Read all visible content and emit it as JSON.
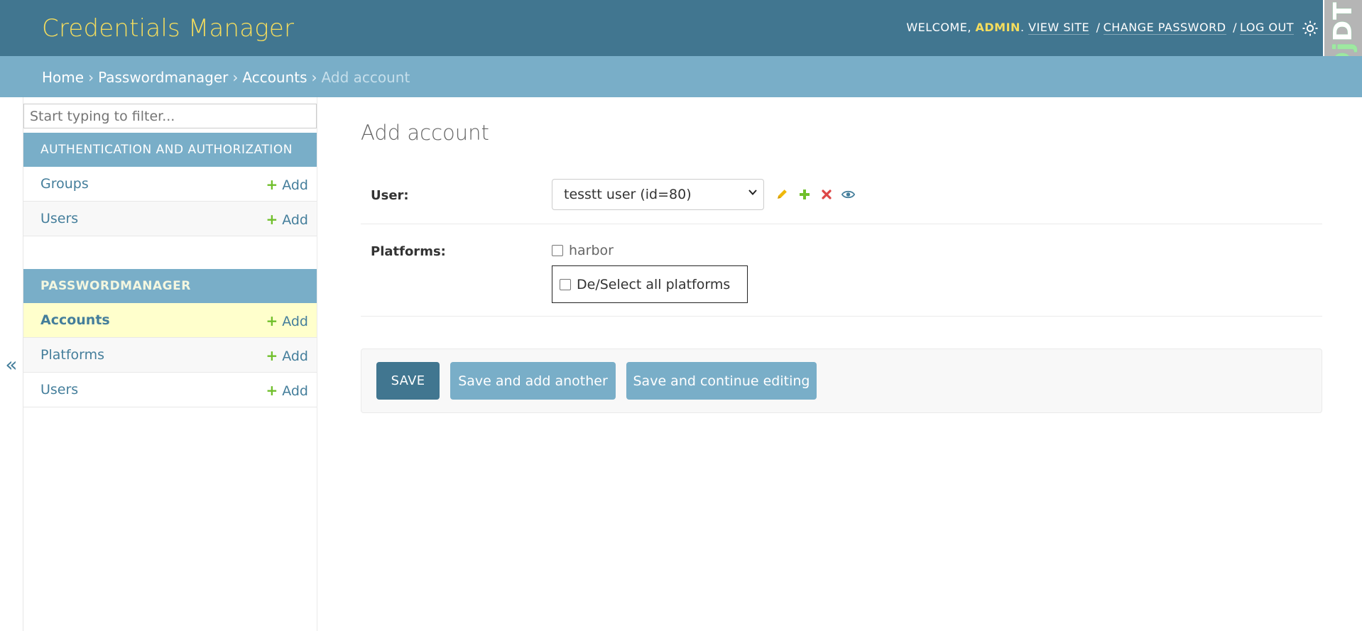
{
  "header": {
    "title": "Credentials Manager",
    "welcome": "WELCOME,",
    "user": "ADMIN",
    "view_site": "VIEW SITE",
    "change_password": "CHANGE PASSWORD",
    "log_out": "LOG OUT",
    "sep": "/"
  },
  "debug_toolbar": {
    "label_dj": "Dj",
    "label_dt": "DT"
  },
  "breadcrumbs": {
    "home": "Home",
    "app": "Passwordmanager",
    "model": "Accounts",
    "current": "Add account",
    "sep": "›"
  },
  "sidebar": {
    "toggle": "«",
    "filter_placeholder": "Start typing to filter...",
    "modules": [
      {
        "caption": "Authentication and Authorization",
        "rows": [
          {
            "label": "Groups",
            "add": "Add"
          },
          {
            "label": "Users",
            "add": "Add"
          }
        ]
      },
      {
        "caption": "PASSWORDMANAGER",
        "rows": [
          {
            "label": "Accounts",
            "add": "Add"
          },
          {
            "label": "Platforms",
            "add": "Add"
          },
          {
            "label": "Users",
            "add": "Add"
          }
        ]
      }
    ],
    "add_icon": "+"
  },
  "content": {
    "title": "Add account",
    "user_label": "User:",
    "user_value": "tesstt user (id=80)",
    "platforms_label": "Platforms:",
    "platform_options": [
      "harbor"
    ],
    "select_all": "De/Select all platforms"
  },
  "actions": {
    "save": "Save",
    "save_add_another": "Save and add another",
    "save_continue": "Save and continue editing"
  },
  "colors": {
    "header_bg": "#417690",
    "breadcrumb_bg": "#79aec8",
    "brand": "#f5dd5d",
    "add_green": "#70bf2b",
    "current_row": "#ffffcc"
  },
  "icons": {
    "change": "pencil-icon",
    "add": "plus-icon",
    "delete": "x-icon",
    "view": "eye-icon",
    "theme": "sun-icon"
  }
}
